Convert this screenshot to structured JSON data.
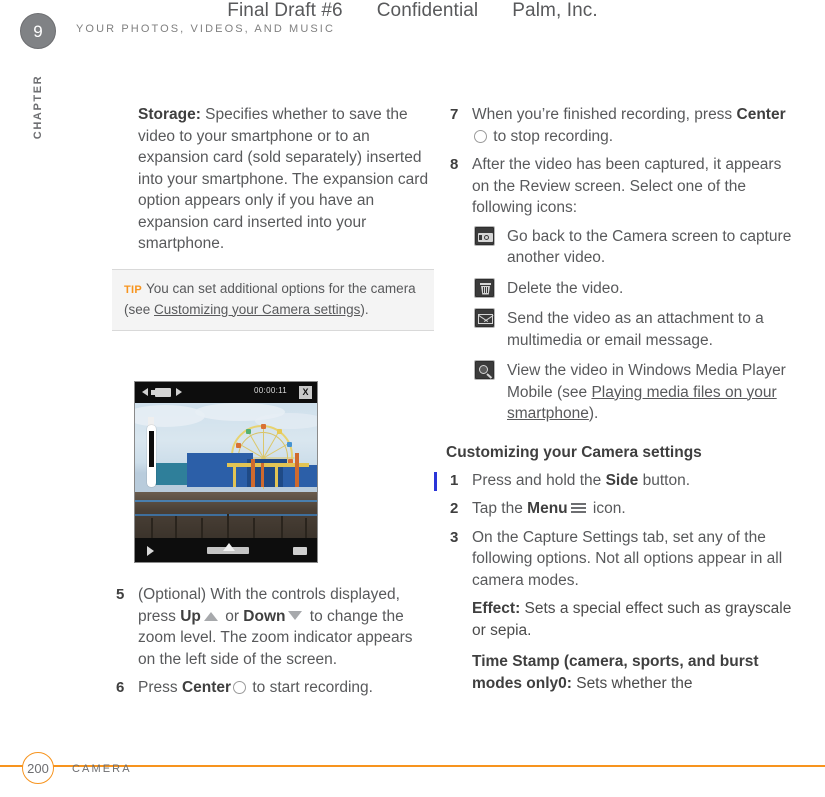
{
  "header": {
    "draft": "Final Draft #6",
    "classification": "Confidential",
    "company": "Palm, Inc.",
    "chapter_title": "YOUR PHOTOS, VIDEOS, AND MUSIC",
    "chapter_number": "9",
    "chapter_word": "CHAPTER"
  },
  "left_column": {
    "storage_para": {
      "lead": "Storage:",
      "text": " Specifies whether to save the video to your smartphone or to an expansion card (sold separately) inserted into your smartphone. The expansion card option appears only if you have an expansion card inserted into your smartphone."
    },
    "tip": {
      "label": "TIP",
      "text_before": "You can set additional options for the camera (see ",
      "link": "Customizing your Camera settings",
      "text_after": ")."
    },
    "screenshot": {
      "name": "camera-review-screenshot",
      "timer": "00:00:11",
      "close_label": "X",
      "caption_alt": "Camera review screen showing a recorded video of a pier with a ferris wheel"
    },
    "steps": [
      {
        "num": "5",
        "parts": [
          {
            "t": "text",
            "v": "(Optional) With the controls displayed, press "
          },
          {
            "t": "bold",
            "v": "Up"
          },
          {
            "t": "icon",
            "v": "triangle-up-icon"
          },
          {
            "t": "text",
            "v": " or "
          },
          {
            "t": "bold",
            "v": "Down"
          },
          {
            "t": "icon",
            "v": "triangle-down-icon"
          },
          {
            "t": "text",
            "v": " to change the zoom level. The zoom indicator appears on the left side of the screen."
          }
        ]
      },
      {
        "num": "6",
        "parts": [
          {
            "t": "text",
            "v": "Press "
          },
          {
            "t": "bold",
            "v": "Center"
          },
          {
            "t": "icon",
            "v": "circle-button-icon"
          },
          {
            "t": "text",
            "v": " to start recording."
          }
        ]
      }
    ]
  },
  "right_column": {
    "steps_top": [
      {
        "num": "7",
        "before": "When you’re finished recording, press ",
        "bold": "Center",
        "icon": "circle-button-icon",
        "after": " to stop recording."
      },
      {
        "num": "8",
        "before": "After the video has been captured, it appears on the Review screen. Select one of the following icons:",
        "bold": "",
        "icon": "",
        "after": ""
      }
    ],
    "icon_list": [
      {
        "icon": "camera-icon",
        "text": "Go back to the Camera screen to capture another video."
      },
      {
        "icon": "trash-icon",
        "text": "Delete the video."
      },
      {
        "icon": "envelope-icon",
        "text": "Send the video as an attachment to a multimedia or email message."
      },
      {
        "icon": "magnifier-icon",
        "text_before": "View the video in Windows Media Player Mobile (see ",
        "link": "Playing media files on your smartphone",
        "text_after": ")."
      }
    ],
    "section_heading": "Customizing your Camera settings",
    "steps_bottom": [
      {
        "num": "1",
        "before": "Press and hold the ",
        "bold": "Side",
        "icon": "",
        "after": " button.",
        "changed": true
      },
      {
        "num": "2",
        "before": "Tap the ",
        "bold": "Menu",
        "icon": "menu-icon",
        "after": " icon.",
        "changed": false
      },
      {
        "num": "3",
        "before": "On the Capture Settings tab, set any of the following options. Not all options appear in all camera modes.",
        "bold": "",
        "icon": "",
        "after": "",
        "changed": false
      }
    ],
    "options": [
      {
        "lead": "Effect:",
        "text": " Sets a special effect such as grayscale or sepia."
      },
      {
        "lead": "Time Stamp (camera, sports, and burst modes only0:",
        "text": " Sets whether the"
      }
    ]
  },
  "footer": {
    "page_number": "200",
    "label": "CAMERA"
  },
  "colors": {
    "accent_orange": "#f7941e",
    "body_gray": "#58595b",
    "chapter_gray": "#808285",
    "change_bar_blue": "#2a35d8"
  }
}
